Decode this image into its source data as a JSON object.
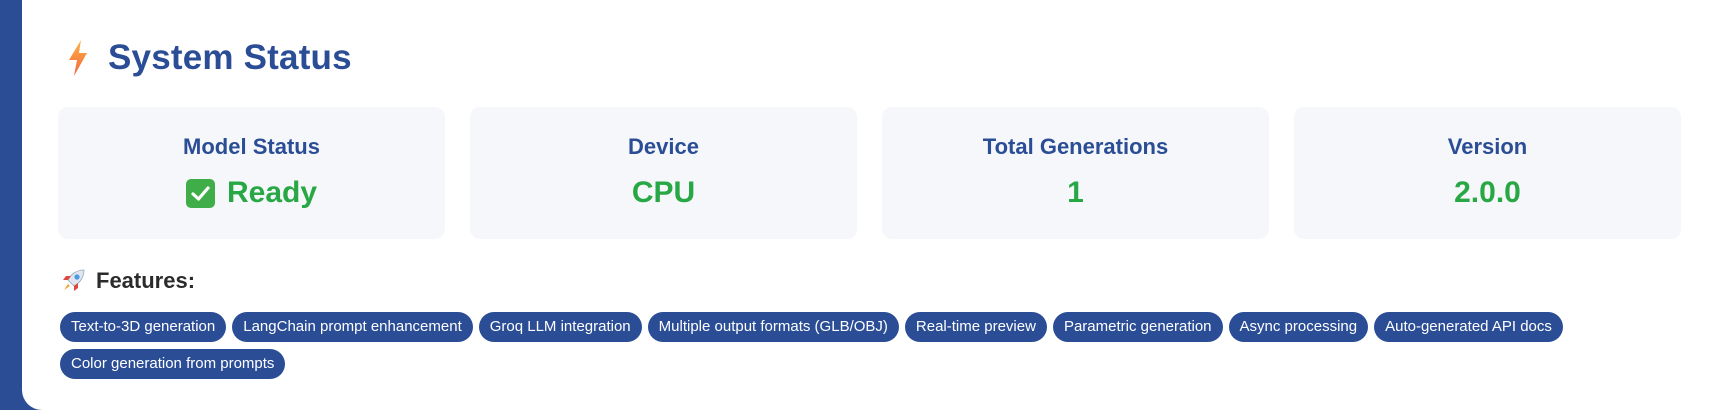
{
  "header": {
    "title": "System Status",
    "icon": "lightning-bolt-icon"
  },
  "cards": [
    {
      "label": "Model Status",
      "value": "Ready",
      "icon": "check-mark-icon"
    },
    {
      "label": "Device",
      "value": "CPU"
    },
    {
      "label": "Total Generations",
      "value": "1"
    },
    {
      "label": "Version",
      "value": "2.0.0"
    }
  ],
  "features": {
    "title": "Features:",
    "icon": "rocket-icon",
    "tags": [
      "Text-to-3D generation",
      "LangChain prompt enhancement",
      "Groq LLM integration",
      "Multiple output formats (GLB/OBJ)",
      "Real-time preview",
      "Parametric generation",
      "Async processing",
      "Auto-generated API docs",
      "Color generation from prompts"
    ]
  },
  "colors": {
    "primary": "#2a4d96",
    "success": "#28a745",
    "card_bg": "#f5f7fa"
  }
}
